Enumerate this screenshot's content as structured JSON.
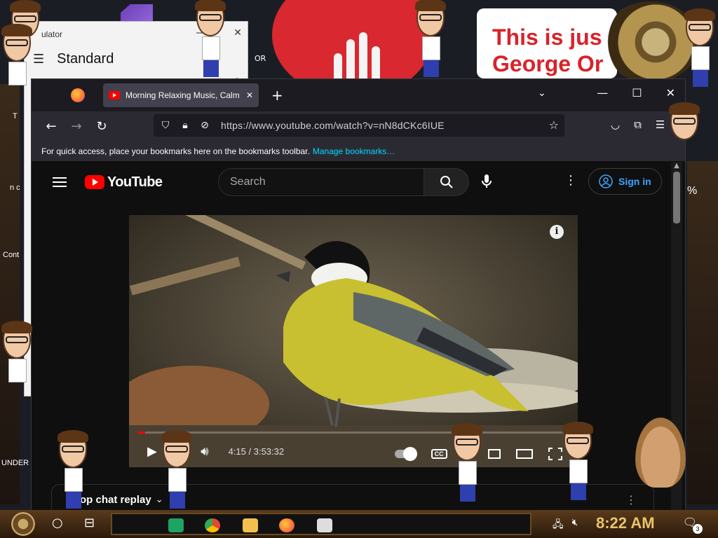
{
  "desktop": {
    "poster_line1": "This is jus",
    "poster_line2": "George Or",
    "left_labels": [
      "T",
      "n c",
      "Cont",
      "UNDER"
    ],
    "right_label": "%"
  },
  "calculator": {
    "title": "ulator",
    "mode": "Standard",
    "minimize": "—",
    "close": "✕",
    "history_icon": "history-icon",
    "fragment_label": "OR"
  },
  "browser": {
    "tab_title": "Morning Relaxing Music, Calm",
    "tab_close": "✕",
    "new_tab": "+",
    "url": "https://www.youtube.com/watch?v=nN8dCKc6IUE",
    "bookmarks_message": "For quick access, place your bookmarks here on the bookmarks toolbar.",
    "bookmarks_link": "Manage bookmarks…",
    "accent": "#00ddff"
  },
  "youtube": {
    "logo_text": "YouTube",
    "search_placeholder": "Search",
    "sign_in": "Sign in",
    "time_display": "4:15 / 3:53:32",
    "progress_fraction": 0.018,
    "info_icon": "i",
    "cc_label": "CC",
    "chat_replay": "op chat replay",
    "brand_color": "#ff0000",
    "link_color": "#3ea6ff"
  },
  "taskbar": {
    "clock": "8:22 AM",
    "notification_count": "3",
    "apps": [
      "sheets-icon",
      "chrome-icon",
      "file-explorer-icon",
      "firefox-icon",
      "calculator-icon"
    ]
  }
}
